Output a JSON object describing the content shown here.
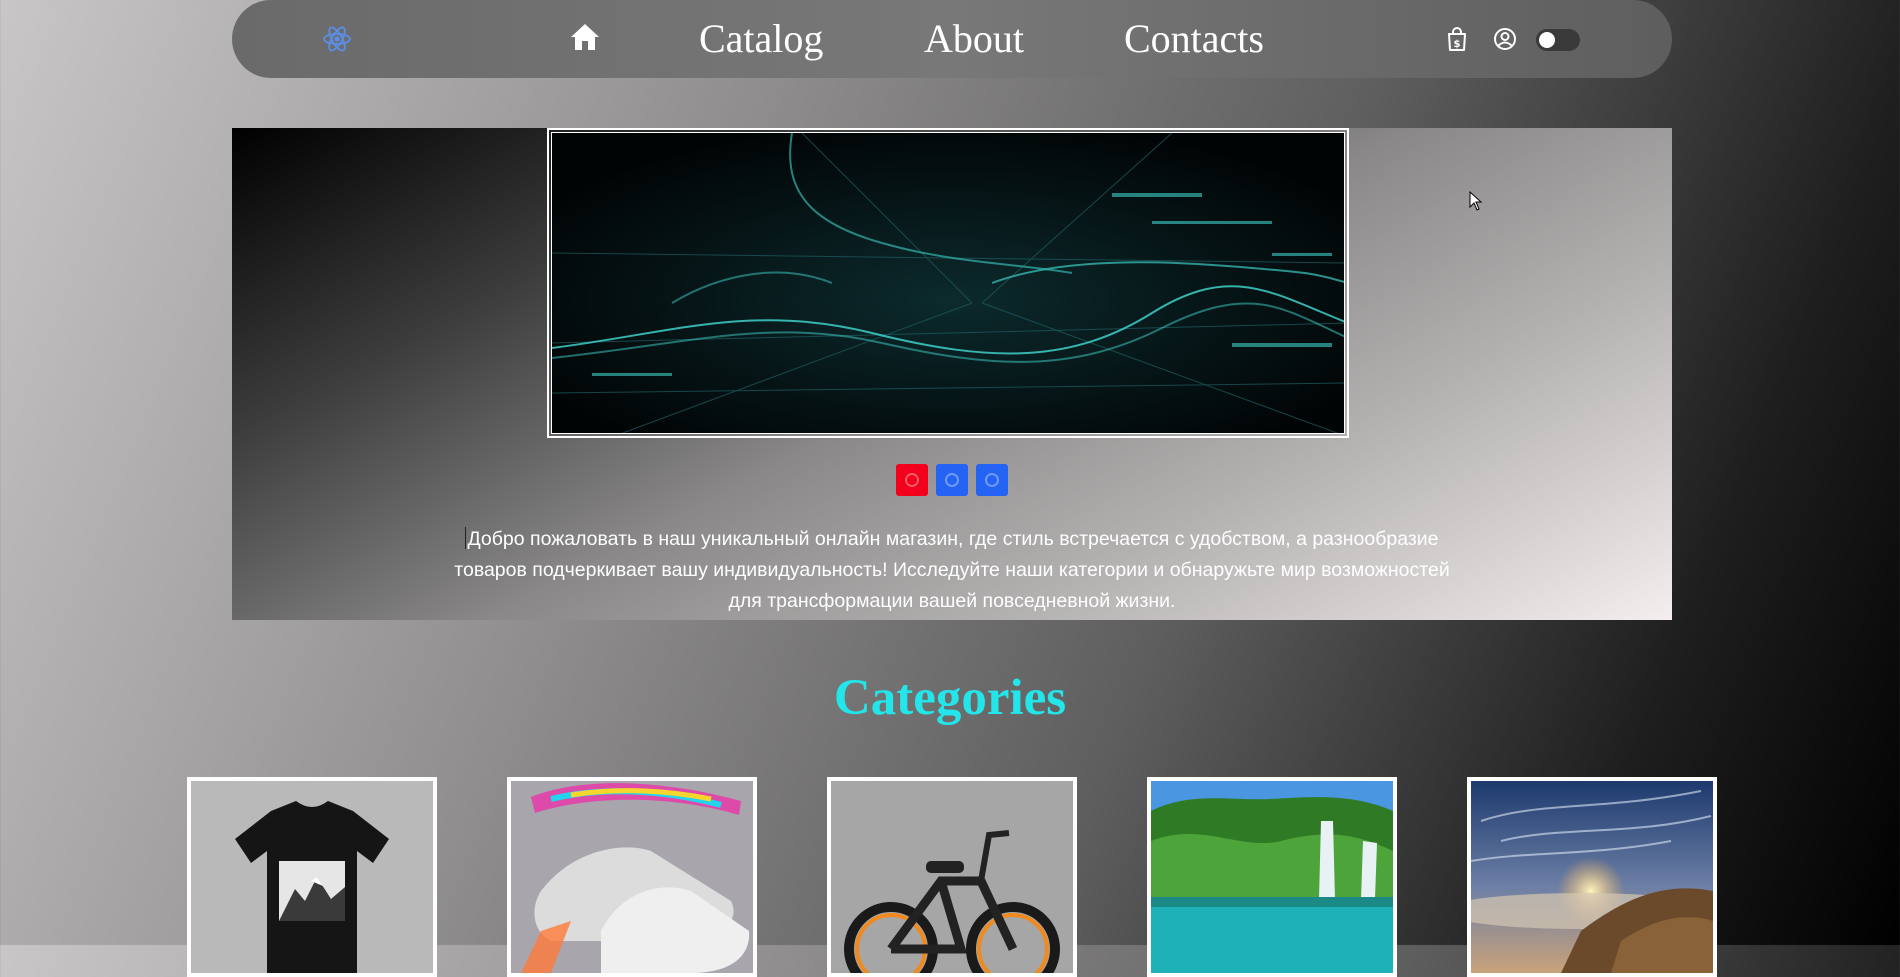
{
  "nav": {
    "logo_icon": "react-atom-icon",
    "home_icon": "home-icon",
    "links": [
      "Catalog",
      "About",
      "Contacts"
    ],
    "cart_icon": "shopping-bag-dollar-icon",
    "user_icon": "user-circle-icon",
    "theme_toggle_icon": "toggle-switch-icon"
  },
  "hero": {
    "slide_image": "abstract teal digital waves",
    "indicator_colors": [
      "#f3001c",
      "#2563f4",
      "#2563f4"
    ],
    "welcome_text": "Добро пожаловать в наш уникальный онлайн магазин, где стиль встречается с удобством, а разнообразие товаров подчеркивает вашу индивидуальность! Исследуйте наши категории и обнаружьте мир возможностей для трансформации вашей повседневной жизни."
  },
  "categories": {
    "title": "Categories",
    "items": [
      {
        "image": "black t-shirt with mountain print"
      },
      {
        "image": "silver sneakers with rainbow ribbon"
      },
      {
        "image": "black and orange electric bicycle"
      },
      {
        "image": "green lake with waterfall"
      },
      {
        "image": "sunset over clouds from mountain"
      }
    ]
  },
  "colors": {
    "accent": "#22e6ea",
    "nav_bg": "#707070",
    "indicator_active": "#f3001c",
    "indicator_inactive": "#2563f4"
  }
}
